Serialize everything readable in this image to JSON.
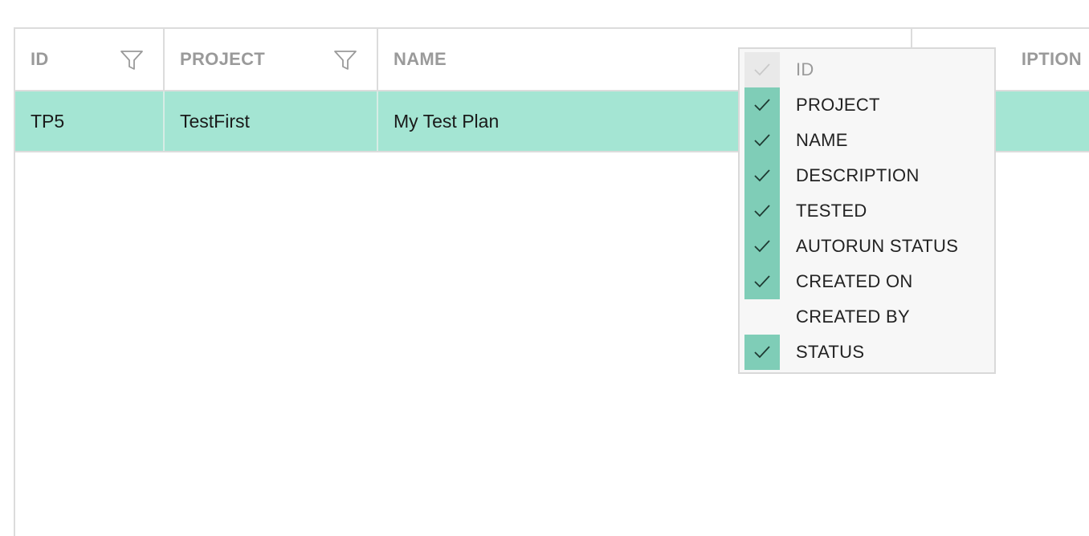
{
  "columns": [
    {
      "label": "ID",
      "filterable": true
    },
    {
      "label": "PROJECT",
      "filterable": true
    },
    {
      "label": "NAME",
      "filterable": false
    },
    {
      "label": "IPTION",
      "filterable": false
    }
  ],
  "rows": [
    {
      "id": "TP5",
      "project": "TestFirst",
      "name": "My Test Plan",
      "description": ""
    }
  ],
  "column_menu": {
    "items": [
      {
        "label": "ID",
        "checked": true,
        "disabled": true
      },
      {
        "label": "PROJECT",
        "checked": true,
        "disabled": false
      },
      {
        "label": "NAME",
        "checked": true,
        "disabled": false
      },
      {
        "label": "DESCRIPTION",
        "checked": true,
        "disabled": false
      },
      {
        "label": "TESTED",
        "checked": true,
        "disabled": false
      },
      {
        "label": "AUTORUN STATUS",
        "checked": true,
        "disabled": false
      },
      {
        "label": "CREATED ON",
        "checked": true,
        "disabled": false
      },
      {
        "label": "CREATED BY",
        "checked": false,
        "disabled": false
      },
      {
        "label": "STATUS",
        "checked": true,
        "disabled": false
      }
    ]
  },
  "colors": {
    "row_selected": "#a4e5d3",
    "check_on": "#7fcdb7",
    "check_disabled": "#e9e9e9",
    "header_text": "#9a9a9a",
    "border": "#dcdcdc"
  },
  "icons": {
    "filter": "filter-funnel-icon",
    "check": "checkmark-icon"
  }
}
